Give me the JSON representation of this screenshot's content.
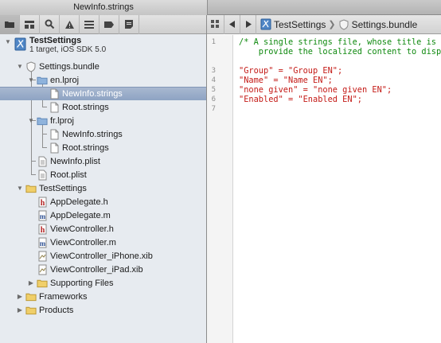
{
  "window": {
    "tab_title": "NewInfo.strings"
  },
  "navigator_toolbar": {
    "buttons": [
      "folder-icon",
      "hierarchy-icon",
      "search-icon",
      "warning-icon",
      "tests-icon",
      "breakpoint-icon",
      "log-icon"
    ]
  },
  "jump_bar": {
    "crumbs": [
      {
        "label": "TestSettings",
        "icon": "xcode-project-icon"
      },
      {
        "label": "Settings.bundle",
        "icon": "bundle-icon"
      }
    ]
  },
  "project": {
    "name": "TestSettings",
    "subtitle": "1 target, iOS SDK 5.0"
  },
  "tree": [
    {
      "label": "Settings.bundle",
      "icon": "bundle",
      "level": 1,
      "disclosure": "open"
    },
    {
      "label": "en.lproj",
      "icon": "folder-blue",
      "level": 2,
      "disclosure": "open"
    },
    {
      "label": "NewInfo.strings",
      "icon": "file",
      "level": 3,
      "selected": true
    },
    {
      "label": "Root.strings",
      "icon": "file",
      "level": 3
    },
    {
      "label": "fr.lproj",
      "icon": "folder-blue",
      "level": 2,
      "disclosure": "open"
    },
    {
      "label": "NewInfo.strings",
      "icon": "file",
      "level": 3
    },
    {
      "label": "Root.strings",
      "icon": "file",
      "level": 3
    },
    {
      "label": "NewInfo.plist",
      "icon": "plist",
      "level": 2
    },
    {
      "label": "Root.plist",
      "icon": "plist",
      "level": 2
    },
    {
      "label": "TestSettings",
      "icon": "folder-yellow",
      "level": 0,
      "disclosure": "open"
    },
    {
      "label": "AppDelegate.h",
      "icon": "header-h",
      "level": 1
    },
    {
      "label": "AppDelegate.m",
      "icon": "source-m",
      "level": 1
    },
    {
      "label": "ViewController.h",
      "icon": "header-h",
      "level": 1
    },
    {
      "label": "ViewController.m",
      "icon": "source-m",
      "level": 1
    },
    {
      "label": "ViewController_iPhone.xib",
      "icon": "xib",
      "level": 1
    },
    {
      "label": "ViewController_iPad.xib",
      "icon": "xib",
      "level": 1
    },
    {
      "label": "Supporting Files",
      "icon": "folder-yellow",
      "level": 1,
      "disclosure": "closed"
    },
    {
      "label": "Frameworks",
      "icon": "folder-yellow",
      "level": 0,
      "disclosure": "closed"
    },
    {
      "label": "Products",
      "icon": "folder-yellow",
      "level": 0,
      "disclosure": "closed"
    }
  ],
  "editor": {
    "line_numbers": [
      "1",
      "",
      "",
      "3",
      "4",
      "5",
      "6",
      "7"
    ],
    "lines": [
      {
        "text": "/* A single strings file, whose title is specified in your preferences schema. The strings files",
        "kind": "comment"
      },
      {
        "text": "    provide the localized content to display to the user for each of your preferences. */",
        "kind": "comment"
      },
      {
        "text": "",
        "kind": "plain"
      },
      {
        "text": "\"Group\" = \"Group EN\";",
        "kind": "string"
      },
      {
        "text": "\"Name\" = \"Name EN\";",
        "kind": "string"
      },
      {
        "text": "\"none given\" = \"none given EN\";",
        "kind": "string"
      },
      {
        "text": "\"Enabled\" = \"Enabled EN\";",
        "kind": "string"
      },
      {
        "text": "",
        "kind": "plain"
      }
    ]
  },
  "colors": {
    "comment": "#108a10",
    "string": "#c41a16",
    "selection": "#8ea3c3",
    "sidebar_bg": "#e7ebf0"
  }
}
